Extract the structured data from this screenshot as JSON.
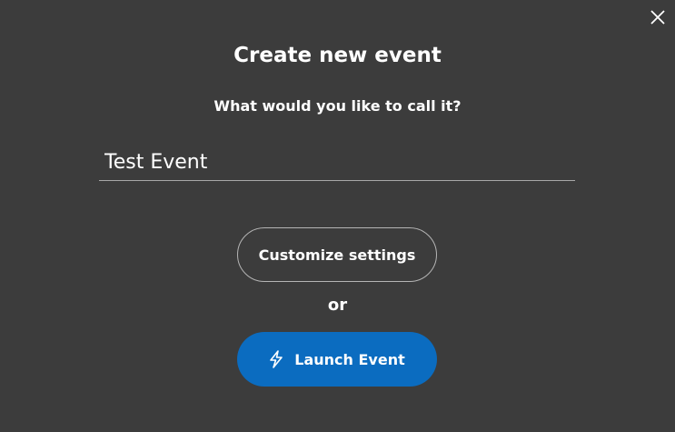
{
  "dialog": {
    "title": "Create new event",
    "prompt": "What would you like to call it?",
    "name_value": "Test Event",
    "customize_label": "Customize settings",
    "or_label": "or",
    "launch_label": "Launch Event"
  },
  "icons": {
    "close": "close-icon",
    "launch": "lightning-bolt-icon"
  },
  "colors": {
    "background": "#3c3c3c",
    "accent": "#0b6cc0",
    "text": "#ffffff"
  }
}
